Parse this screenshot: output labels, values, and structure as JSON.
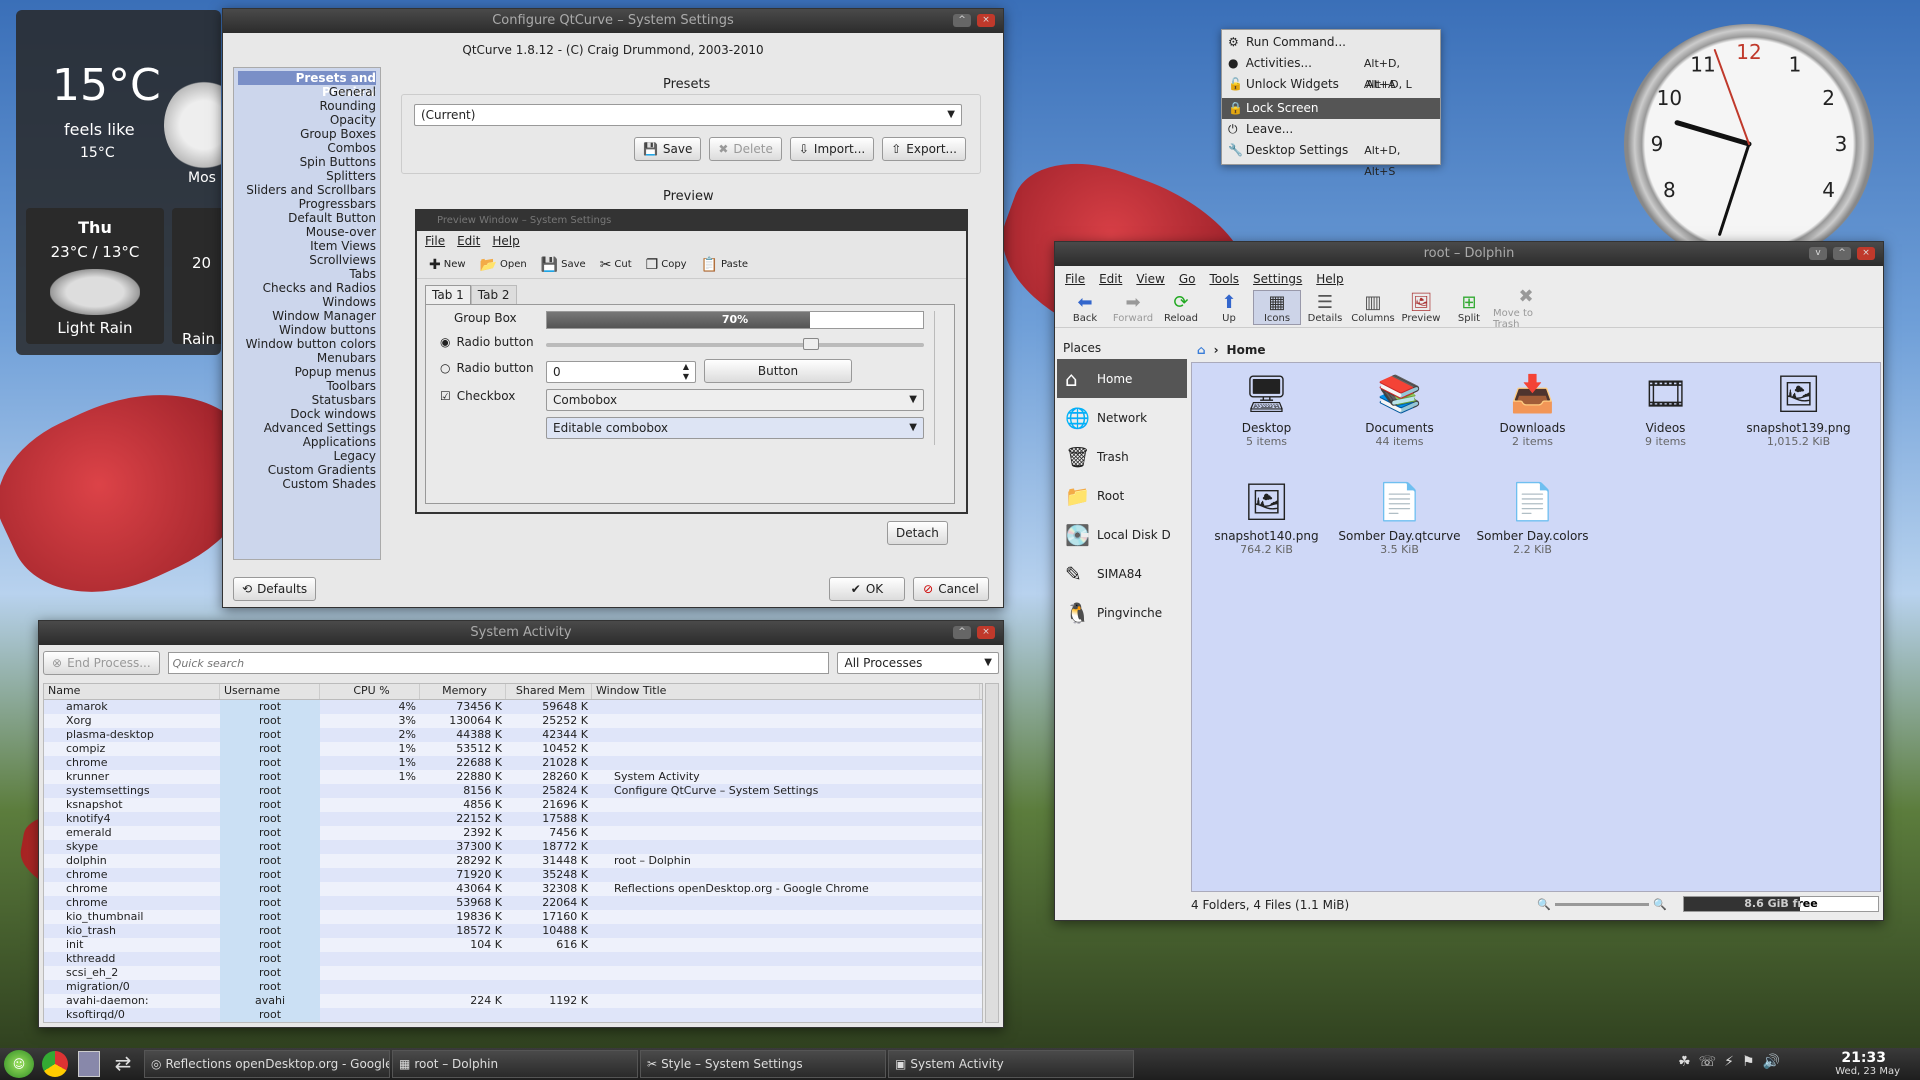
{
  "weather": {
    "temp": "15°C",
    "feels_like": "feels like",
    "feels_temp": "15°C",
    "fragment": "Mos",
    "days": [
      {
        "day": "Thu",
        "temps": "23°C / 13°C",
        "cond": "Light Rain"
      },
      {
        "day": "",
        "temps": "20",
        "cond": "Rain"
      }
    ]
  },
  "qtcurve": {
    "title": "Configure QtCurve – System Settings",
    "header": "QtCurve 1.8.12 - (C) Craig Drummond, 2003-2010",
    "nav": [
      "Presets and Preview",
      "General",
      "Rounding",
      "Opacity",
      "Group Boxes",
      "Combos",
      "Spin Buttons",
      "Splitters",
      "Sliders and Scrollbars",
      "Progressbars",
      "Default Button",
      "Mouse-over",
      "Item Views",
      "Scrollviews",
      "Tabs",
      "Checks and Radios",
      "Windows",
      "Window Manager",
      "Window buttons",
      "Window button colors",
      "Menubars",
      "Popup menus",
      "Toolbars",
      "Statusbars",
      "Dock windows",
      "Advanced Settings",
      "Applications",
      "Legacy",
      "Custom Gradients",
      "Custom Shades"
    ],
    "presets_label": "Presets",
    "preset_value": "(Current)",
    "save": "Save",
    "delete": "Delete",
    "import": "Import...",
    "export": "Export...",
    "preview_label": "Preview",
    "detach": "Detach",
    "defaults": "Defaults",
    "ok": "OK",
    "cancel": "Cancel",
    "preview": {
      "title": "Preview Window – System Settings",
      "menus": [
        "File",
        "Edit",
        "Help"
      ],
      "tools": [
        "New",
        "Open",
        "Save",
        "Cut",
        "Copy",
        "Paste"
      ],
      "tab1": "Tab 1",
      "tab2": "Tab 2",
      "groupbox": "Group Box",
      "radio1": "Radio button",
      "radio2": "Radio button",
      "checkbox": "Checkbox",
      "progress": "70%",
      "progress_value": 0.7,
      "slider_value": 0.7,
      "spin": "0",
      "button": "Button",
      "combo": "Combobox",
      "editable": "Editable combobox"
    }
  },
  "krunner_menu": [
    {
      "label": "Run Command...",
      "key": ""
    },
    {
      "label": "Activities...",
      "key": "Alt+D, Alt+A"
    },
    {
      "label": "Unlock Widgets",
      "key": "Alt+D, L"
    },
    {
      "label": "Lock Screen",
      "key": ""
    },
    {
      "label": "Leave...",
      "key": ""
    },
    {
      "label": "Desktop Settings",
      "key": "Alt+D, Alt+S"
    }
  ],
  "clock": {
    "numbers": [
      "12",
      "1",
      "2",
      "3",
      "4",
      "8",
      "9",
      "10",
      "11"
    ]
  },
  "dolphin": {
    "title": "root – Dolphin",
    "menus": [
      "File",
      "Edit",
      "View",
      "Go",
      "Tools",
      "Settings",
      "Help"
    ],
    "tools": [
      "Back",
      "Forward",
      "Reload",
      "Up",
      "Icons",
      "Details",
      "Columns",
      "Preview",
      "Split",
      "Move to Trash"
    ],
    "places_title": "Places",
    "places": [
      "Home",
      "Network",
      "Trash",
      "Root",
      "Local Disk D",
      "SIMA84",
      "Pingvinche"
    ],
    "location": "Home",
    "files": [
      {
        "name": "Desktop",
        "info": "5 items"
      },
      {
        "name": "Documents",
        "info": "44 items"
      },
      {
        "name": "Downloads",
        "info": "2 items"
      },
      {
        "name": "Videos",
        "info": "9 items"
      },
      {
        "name": "snapshot139.png",
        "info": "1,015.2 KiB"
      },
      {
        "name": "snapshot140.png",
        "info": "764.2 KiB"
      },
      {
        "name": "Somber Day.qtcurve",
        "info": "3.5 KiB"
      },
      {
        "name": "Somber Day.colors",
        "info": "2.2 KiB"
      }
    ],
    "status": "4 Folders, 4 Files (1.1 MiB)",
    "free": "8.6 GiB free",
    "free_fraction": 0.6
  },
  "sysact": {
    "title": "System Activity",
    "end_process": "End Process...",
    "search_placeholder": "Quick search",
    "filter": "All Processes",
    "headers": [
      "Name",
      "Username",
      "CPU %",
      "Memory",
      "Shared Mem",
      "Window Title"
    ],
    "rows": [
      [
        "amarok",
        "root",
        "4%",
        "73456 K",
        "59648 K",
        ""
      ],
      [
        "Xorg",
        "root",
        "3%",
        "130064 K",
        "25252 K",
        ""
      ],
      [
        "plasma-desktop",
        "root",
        "2%",
        "44388 K",
        "42344 K",
        ""
      ],
      [
        "compiz",
        "root",
        "1%",
        "53512 K",
        "10452 K",
        ""
      ],
      [
        "chrome",
        "root",
        "1%",
        "22688 K",
        "21028 K",
        ""
      ],
      [
        "krunner",
        "root",
        "1%",
        "22880 K",
        "28260 K",
        "System Activity"
      ],
      [
        "systemsettings",
        "root",
        "",
        "8156 K",
        "25824 K",
        "Configure QtCurve – System Settings"
      ],
      [
        "ksnapshot",
        "root",
        "",
        "4856 K",
        "21696 K",
        ""
      ],
      [
        "knotify4",
        "root",
        "",
        "22152 K",
        "17588 K",
        ""
      ],
      [
        "emerald",
        "root",
        "",
        "2392 K",
        "7456 K",
        ""
      ],
      [
        "skype",
        "root",
        "",
        "37300 K",
        "18772 K",
        ""
      ],
      [
        "dolphin",
        "root",
        "",
        "28292 K",
        "31448 K",
        "root – Dolphin"
      ],
      [
        "chrome",
        "root",
        "",
        "71920 K",
        "35248 K",
        ""
      ],
      [
        "chrome",
        "root",
        "",
        "43064 K",
        "32308 K",
        "Reflections openDesktop.org - Google Chrome"
      ],
      [
        "chrome",
        "root",
        "",
        "53968 K",
        "22064 K",
        ""
      ],
      [
        "kio_thumbnail",
        "root",
        "",
        "19836 K",
        "17160 K",
        ""
      ],
      [
        "kio_trash",
        "root",
        "",
        "18572 K",
        "10488 K",
        ""
      ],
      [
        "init",
        "root",
        "",
        "104 K",
        "616 K",
        ""
      ],
      [
        "kthreadd",
        "root",
        "",
        "",
        "",
        ""
      ],
      [
        "scsi_eh_2",
        "root",
        "",
        "",
        "",
        ""
      ],
      [
        "migration/0",
        "root",
        "",
        "",
        "",
        ""
      ],
      [
        "avahi-daemon:",
        "avahi",
        "",
        "224 K",
        "1192 K",
        ""
      ],
      [
        "ksoftirqd/0",
        "root",
        "",
        "",
        "",
        ""
      ]
    ]
  },
  "taskbar": {
    "tasks": [
      "Reflections openDesktop.org - Google",
      "root – Dolphin",
      "Style – System Settings",
      "System Activity"
    ],
    "time": "21:33",
    "date": "Wed, 23 May"
  }
}
